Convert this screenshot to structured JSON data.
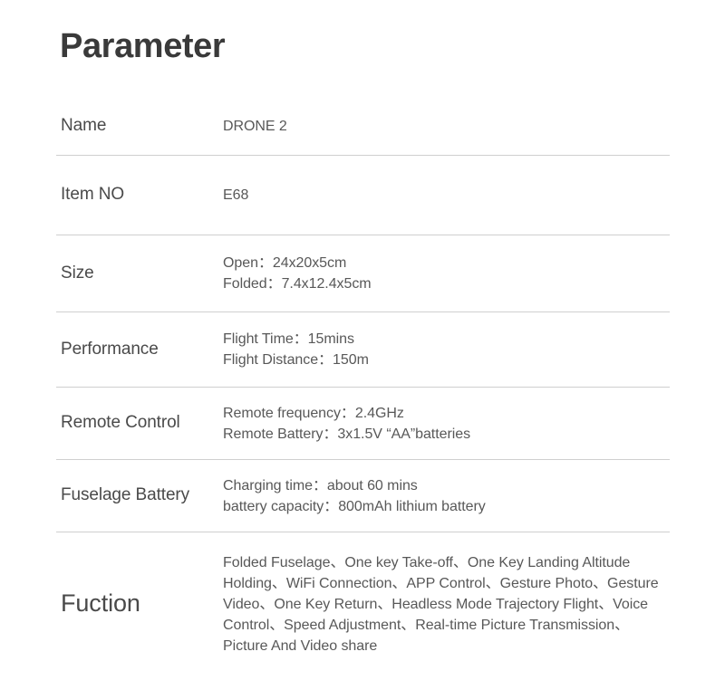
{
  "document": {
    "title": "Parameter"
  },
  "table": {
    "rows": [
      {
        "label": "Name",
        "lines": [
          "DRONE 2"
        ]
      },
      {
        "label": "Item NO",
        "lines": [
          "E68"
        ]
      },
      {
        "label": "Size",
        "lines": [
          "Open：24x20x5cm",
          "Folded：7.4x12.4x5cm"
        ]
      },
      {
        "label": "Performance",
        "lines": [
          "Flight Time：15mins",
          "Flight Distance：150m"
        ]
      },
      {
        "label": "Remote Control",
        "lines": [
          "Remote frequency：2.4GHz",
          "Remote Battery：3x1.5V “AA”batteries"
        ]
      },
      {
        "label": "Fuselage Battery",
        "lines": [
          "Charging time：about 60 mins",
          "battery capacity：800mAh lithium battery"
        ]
      },
      {
        "label": "Fuction",
        "lines": [
          "Folded Fuselage、One key Take-off、One Key Landing Altitude Holding、WiFi Connection、APP Control、Gesture Photo、Gesture Video、One Key Return、Headless Mode Trajectory Flight、Voice Control、Speed Adjustment、Real-time Picture Transmission、Picture And Video share"
        ]
      }
    ]
  },
  "style": {
    "text_color": "#585858",
    "label_color": "#4a4a4a",
    "title_color": "#3a3a3a",
    "divider_color": "#cfcfcf",
    "background": "#ffffff"
  }
}
